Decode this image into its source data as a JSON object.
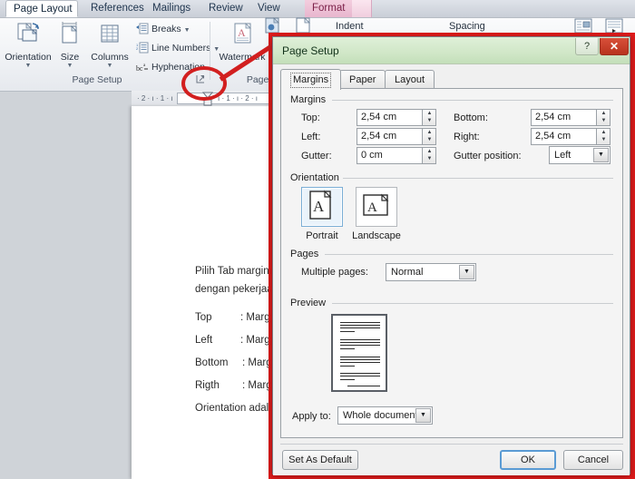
{
  "ribbon": {
    "tabs": [
      {
        "label": "Page Layout",
        "state": "active"
      },
      {
        "label": "References",
        "state": "normal"
      },
      {
        "label": "Mailings",
        "state": "normal"
      },
      {
        "label": "Review",
        "state": "normal"
      },
      {
        "label": "View",
        "state": "normal"
      },
      {
        "label": "Format",
        "state": "contextual"
      }
    ],
    "groups": [
      {
        "label": "Page Setup"
      },
      {
        "label": "Page Ba"
      }
    ],
    "page_setup": {
      "orientation": "Orientation",
      "size": "Size",
      "columns": "Columns",
      "breaks": "Breaks",
      "line_numbers": "Line Numbers",
      "hyphenation": "Hyphenation"
    },
    "page_background": {
      "watermark": "Watermark"
    },
    "paragraph": {
      "indent": "Indent",
      "spacing": "Spacing"
    }
  },
  "ruler": {
    "left_ticks": "· 2 · ı · 1 · ı",
    "right_ticks": "ı · 1 · ı · 2 · ı"
  },
  "document": {
    "lines": [
      "Pilih Tab margin",
      "dengan pekerjaa"
    ],
    "entries": [
      {
        "key": "Top",
        "value": ": Margin"
      },
      {
        "key": "Left",
        "value": ": Margin"
      },
      {
        "key": "Bottom",
        "value": ": Margin"
      },
      {
        "key": "Rigth",
        "value": ": Margin"
      }
    ],
    "closing": "Orientation adala"
  },
  "dialog": {
    "title": "Page Setup",
    "help_label": "?",
    "close_label": "✕",
    "tabs": [
      {
        "label": "Margins",
        "selected": true
      },
      {
        "label": "Paper",
        "selected": false
      },
      {
        "label": "Layout",
        "selected": false
      }
    ],
    "margins": {
      "caption": "Margins",
      "fields": [
        {
          "label": "Top:",
          "value": "2,54 cm"
        },
        {
          "label": "Bottom:",
          "value": "2,54 cm"
        },
        {
          "label": "Left:",
          "value": "2,54 cm"
        },
        {
          "label": "Right:",
          "value": "2,54 cm"
        },
        {
          "label": "Gutter:",
          "value": "0 cm"
        }
      ],
      "gutter_position_label": "Gutter position:",
      "gutter_position_value": "Left"
    },
    "orientation": {
      "caption": "Orientation",
      "portrait": "Portrait",
      "landscape": "Landscape",
      "selected": "Portrait",
      "glyph": "A"
    },
    "pages": {
      "caption": "Pages",
      "multiple_pages_label": "Multiple pages:",
      "multiple_pages_value": "Normal"
    },
    "preview": {
      "caption": "Preview",
      "apply_to_label": "Apply to:",
      "apply_to_value": "Whole document"
    },
    "buttons": {
      "set_as_default": "Set As Default",
      "ok": "OK",
      "cancel": "Cancel"
    }
  },
  "colors": {
    "annotation_red": "#e01b1b",
    "dialog_title_green": "#cfe6c6",
    "contextual_tab_pink": "#f0cede",
    "accent_blue": "#5a9bd4"
  }
}
